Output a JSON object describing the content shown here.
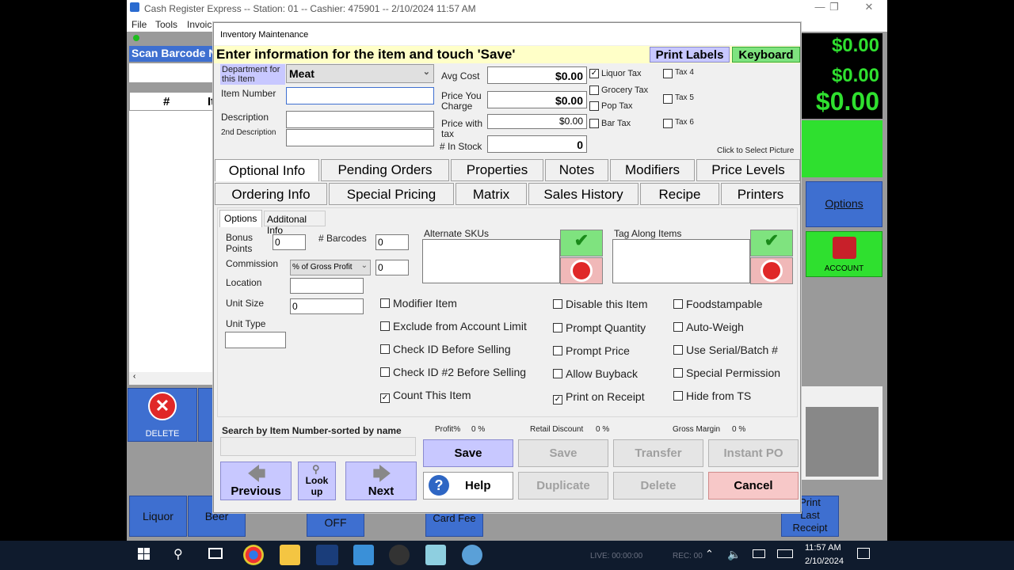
{
  "window": {
    "title": "Cash Register Express -- Station: 01 -- Cashier: 475901 -- 2/10/2024 11:57 AM"
  },
  "menu": [
    "File",
    "Tools",
    "Invoice"
  ],
  "background": {
    "scan_barcode_label": "Scan Barcode N",
    "grid_headers": [
      "#",
      "It"
    ],
    "totals": [
      "$0.00",
      "$0.00",
      "$0.00"
    ],
    "options_label": "Options",
    "account_label": "ACCOUNT",
    "delete_label": "DELETE",
    "bottom_buttons": [
      "Liquor",
      "Beer",
      "OFF",
      "Card Fee",
      "Print Last Receipt"
    ]
  },
  "dialog": {
    "title": "Inventory Maintenance",
    "header": "Enter information for the item and touch 'Save'",
    "print_labels": "Print Labels",
    "keyboard": "Keyboard",
    "department_label": "Department for this Item",
    "department_value": "Meat",
    "item_number_label": "Item Number",
    "item_number_value": "",
    "description_label": "Description",
    "description_value": "",
    "description2_label": "2nd Description",
    "description2_value": "",
    "avg_cost_label": "Avg Cost",
    "avg_cost_value": "$0.00",
    "price_label": "Price You Charge",
    "price_value": "$0.00",
    "price_tax_label": "Price with tax",
    "price_tax_value": "$0.00",
    "in_stock_label": "# In Stock",
    "in_stock_value": "0",
    "taxes": [
      {
        "label": "Liquor Tax",
        "checked": true
      },
      {
        "label": "Grocery Tax",
        "checked": false
      },
      {
        "label": "Pop Tax",
        "checked": false
      },
      {
        "label": "Bar Tax",
        "checked": false
      },
      {
        "label": "Tax 4",
        "checked": false
      },
      {
        "label": "Tax 5",
        "checked": false
      },
      {
        "label": "Tax 6",
        "checked": false
      }
    ],
    "picture_hint": "Click to Select Picture",
    "tabs_row1": [
      "Optional Info",
      "Pending Orders",
      "Properties",
      "Notes",
      "Modifiers",
      "Price Levels"
    ],
    "tabs_row2": [
      "Ordering Info",
      "Special Pricing",
      "Matrix",
      "Sales History",
      "Recipe",
      "Printers"
    ],
    "subtabs": [
      "Options",
      "Additonal Info"
    ],
    "bonus_points_label": "Bonus Points",
    "bonus_points_value": "0",
    "barcodes_label": "# Barcodes",
    "barcodes_value": "0",
    "commission_label": "Commission",
    "commission_type": "% of Gross Profit",
    "commission_value": "0",
    "location_label": "Location",
    "location_value": "",
    "unit_size_label": "Unit Size",
    "unit_size_value": "0",
    "unit_type_label": "Unit Type",
    "unit_type_value": "",
    "alt_skus_label": "Alternate SKUs",
    "tag_along_label": "Tag Along Items",
    "checks_col1": [
      {
        "label": "Modifier Item",
        "checked": false
      },
      {
        "label": "Exclude from Account Limit",
        "checked": false
      },
      {
        "label": "Check ID Before Selling",
        "checked": false
      },
      {
        "label": "Check ID #2 Before Selling",
        "checked": false
      },
      {
        "label": "Count This Item",
        "checked": true
      }
    ],
    "checks_col2": [
      {
        "label": "Disable this Item",
        "checked": false
      },
      {
        "label": "Prompt Quantity",
        "checked": false
      },
      {
        "label": "Prompt Price",
        "checked": false
      },
      {
        "label": "Allow Buyback",
        "checked": false
      },
      {
        "label": "Print on Receipt",
        "checked": true
      }
    ],
    "checks_col3": [
      {
        "label": "Foodstampable",
        "checked": false
      },
      {
        "label": "Auto-Weigh",
        "checked": false
      },
      {
        "label": "Use Serial/Batch #",
        "checked": false
      },
      {
        "label": "Special Permission",
        "checked": false
      },
      {
        "label": "Hide from TS",
        "checked": false
      }
    ],
    "search_label": "Search by Item Number-sorted by name",
    "profit_label": "Profit%",
    "profit_value": "0 %",
    "retail_discount_label": "Retail Discount",
    "retail_discount_value": "0 %",
    "gross_margin_label": "Gross Margin",
    "gross_margin_value": "0 %",
    "buttons": {
      "save1": "Save",
      "save2": "Save",
      "transfer": "Transfer",
      "instant_po": "Instant PO",
      "help": "Help",
      "duplicate": "Duplicate",
      "delete": "Delete",
      "cancel": "Cancel",
      "previous": "Previous",
      "lookup": "Look up",
      "next": "Next"
    }
  },
  "taskbar": {
    "live": "LIVE: 00:00:00",
    "rec": "REC: 00",
    "time": "11:57 AM",
    "date": "2/10/2024"
  },
  "colors": {
    "accent_blue": "#3e6fd0",
    "green": "#2fe02f",
    "dialog_header": "#ffffc8",
    "cancel": "#f7c8c8"
  }
}
